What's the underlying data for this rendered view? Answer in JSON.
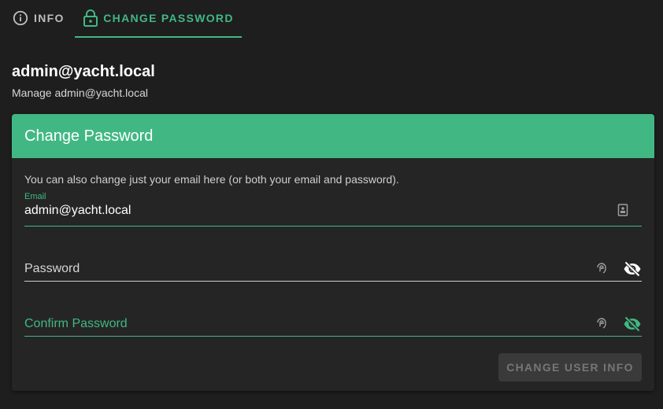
{
  "tabs": [
    {
      "label": "INFO",
      "icon": "info-circle-icon",
      "active": false
    },
    {
      "label": "CHANGE PASSWORD",
      "icon": "lock-icon",
      "active": true
    }
  ],
  "user": {
    "title": "admin@yacht.local",
    "subtitle": "Manage admin@yacht.local"
  },
  "card": {
    "title": "Change Password",
    "hint": "You can also change just your email here (or both your email and password).",
    "email": {
      "label": "Email",
      "value": "admin@yacht.local",
      "icon": "contact-card-icon"
    },
    "password": {
      "placeholder": "Password",
      "icon": "fingerprint-icon",
      "toggle_icon": "eye-off-icon"
    },
    "confirm": {
      "placeholder": "Confirm Password",
      "icon": "fingerprint-icon",
      "toggle_icon": "eye-off-icon"
    },
    "submit_label": "CHANGE USER INFO",
    "submit_enabled": false
  },
  "colors": {
    "accent": "#41b883",
    "background": "#1e1e1e",
    "card": "#252525"
  }
}
